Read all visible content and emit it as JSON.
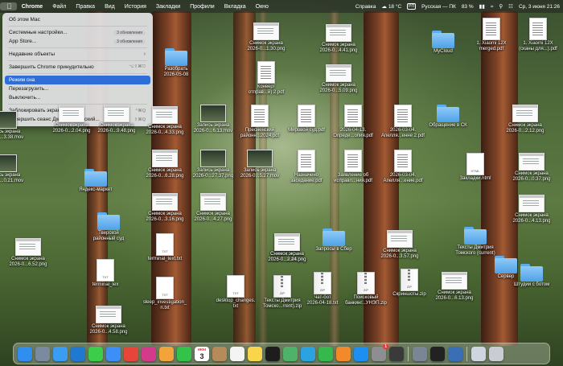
{
  "menubar": {
    "apple_icon": "apple-icon",
    "app_name": "Chrome",
    "menus": [
      "Файл",
      "Правка",
      "Вид",
      "История",
      "Закладки",
      "Профили",
      "Вкладка",
      "Окно"
    ],
    "right": {
      "help": "Справка",
      "weather": "18 °C",
      "keyboard_badge": "РП",
      "input_source": "Русская — ПК",
      "battery": "83 %",
      "datetime": "Ср, 3 июня 21:26"
    }
  },
  "apple_menu": {
    "items": [
      {
        "label": "Об этом Mac"
      },
      {
        "separator": true
      },
      {
        "label": "Системные настройки...",
        "badge": "3 обновления"
      },
      {
        "label": "App Store...",
        "badge": "3 обновления"
      },
      {
        "separator": true
      },
      {
        "label": "Недавние объекты",
        "submenu": "›"
      },
      {
        "separator": true
      },
      {
        "label": "Завершить Chrome принудительно",
        "shortcut": "⌥⇧⌘⎋"
      },
      {
        "separator": true
      },
      {
        "label": "Режим сна",
        "highlighted": true
      },
      {
        "label": "Перезагрузить..."
      },
      {
        "label": "Выключить..."
      },
      {
        "separator": true
      },
      {
        "label": "Заблокировать экран",
        "shortcut": "^⌘Q"
      },
      {
        "label": "Завершить сеанс Дмитрий Томский...",
        "shortcut": "⇧⌘Q"
      }
    ]
  },
  "desktop": {
    "items": [
      {
        "kind": "shot",
        "label": "Снимок экрана\n2026-0...1.30.png"
      },
      {
        "kind": "shot",
        "label": "Снимок экрана\n2026-0...4.41.png"
      },
      {
        "kind": "doc",
        "label": "1. Xiaomi 12X\nmerged.pdf"
      },
      {
        "kind": "doc",
        "label": "1. Xiaomi 12X\n(сканы для...).pdf"
      },
      {
        "kind": "folder",
        "label": "MyCloud"
      },
      {
        "kind": "folder",
        "label": "Разобрать\n2026-05-08"
      },
      {
        "kind": "doc",
        "label": "Конверт\nотправ...й) 2.pdf"
      },
      {
        "kind": "shot",
        "label": "Снимок экрана\n2026-0...5.09.png"
      },
      {
        "kind": "mov",
        "label": "Запись экрана\n2026-0...3.38.mov"
      },
      {
        "kind": "shot",
        "label": "Снимок экрана\n2026-0...2.04.png"
      },
      {
        "kind": "shot",
        "label": "Снимок экрана\n2026-0...9.48.png"
      },
      {
        "kind": "shot",
        "label": "Снимок экрана\n2026-0...4.33.png"
      },
      {
        "kind": "mov",
        "label": "Запись экрана\n2026-0...6.13.mov"
      },
      {
        "kind": "doc",
        "label": "Пресненский\nрайонн...2024.pdf"
      },
      {
        "kind": "doc",
        "label": "Мировой суд.pdf"
      },
      {
        "kind": "doc",
        "label": "2026-04-13.\nОпреде...опия.pdf"
      },
      {
        "kind": "doc",
        "label": "2026-03-04.\nАпелля...енне 2.pdf"
      },
      {
        "kind": "folder",
        "label": "Обращение в СК"
      },
      {
        "kind": "shot",
        "label": "Снимок экрана\n2026-0...2.12.png"
      },
      {
        "kind": "mov",
        "label": "Запись экрана\n2026-0...0.21.mov"
      },
      {
        "kind": "shot",
        "label": "Снимок экрана\n2026-0...6.28.png"
      },
      {
        "kind": "mov",
        "label": "Запись экрана\n2026-0...27.37.png"
      },
      {
        "kind": "mov",
        "label": "Запись экрана\n2026-0...5.27.mov"
      },
      {
        "kind": "doc",
        "label": "Назначено\nзаседание.pdf"
      },
      {
        "kind": "doc",
        "label": "Заявление об\nисправл...ния.pdf"
      },
      {
        "kind": "doc",
        "label": "2026-03-04.\nАпелля...ение.pdf"
      },
      {
        "kind": "html",
        "label": "Закладки.html"
      },
      {
        "kind": "shot",
        "label": "Снимок экрана\n2026-0...0.37.png"
      },
      {
        "kind": "folder",
        "label": "Яндекс-маркет"
      },
      {
        "kind": "shot",
        "label": "Снимок экрана\n2026-0...3.16.png"
      },
      {
        "kind": "shot",
        "label": "Снимок экрана\n2026-0...4.27.png"
      },
      {
        "kind": "shot",
        "label": "Снимок экрана\n2026-0...4.13.png"
      },
      {
        "kind": "folder",
        "label": "Тверской\nрайонный суд"
      },
      {
        "kind": "txt",
        "label": "terminal_text.txt"
      },
      {
        "kind": "shot",
        "label": "Снимок экрана\n2026-0...8.46.png"
      },
      {
        "kind": "folder",
        "label": "Запросы в Сбер"
      },
      {
        "kind": "shot",
        "label": "Снимок экрана\n2026-0...3.57.png"
      },
      {
        "kind": "folder",
        "label": "Тексты Дмитрия\nТомского (current)"
      },
      {
        "kind": "shot",
        "label": "Снимок экрана\n2026-0...6.52.png"
      },
      {
        "kind": "shot",
        "label": "Снимок экрана\n2026-0...2.24.png"
      },
      {
        "kind": "folder",
        "label": "Штудии с ботом"
      },
      {
        "kind": "txt",
        "label": "terminal_tex"
      },
      {
        "kind": "txt",
        "label": "sleep_investigation_\nn.txt"
      },
      {
        "kind": "txt",
        "label": "desktop_changes.\ntxt"
      },
      {
        "kind": "zip",
        "label": "Тексты Дмитрия\nТомско...rrent).zip"
      },
      {
        "kind": "zip",
        "label": "Чат-бот\n2026-04-18.txt"
      },
      {
        "kind": "zip",
        "label": "Поисковый\nбанкинг...УНЭП.zip"
      },
      {
        "kind": "zip",
        "label": "Скриншоты.zip"
      },
      {
        "kind": "shot",
        "label": "Снимок экрана\n2026-0...6.13.png"
      },
      {
        "kind": "folder",
        "label": "Сервер"
      },
      {
        "kind": "shot",
        "label": "Снимок экрана\n2026-0...4.58.png"
      }
    ]
  },
  "dock": {
    "calendar_month": "июн",
    "calendar_day": "3",
    "settings_badge": "1",
    "apps": [
      {
        "name": "finder-icon",
        "color": "#2f8ef0"
      },
      {
        "name": "launchpad-icon",
        "color": "#7c8aa0"
      },
      {
        "name": "safari-icon",
        "color": "#3a9cf2"
      },
      {
        "name": "vscode-icon",
        "color": "#1f79d0"
      },
      {
        "name": "messages-icon",
        "color": "#3ccd4b"
      },
      {
        "name": "mail-icon",
        "color": "#3d8ef6"
      },
      {
        "name": "chrome-icon",
        "color": "#e7453a"
      },
      {
        "name": "yandex-browser-icon",
        "color": "#d43a8a"
      },
      {
        "name": "photos-icon",
        "color": "#f2a33a"
      },
      {
        "name": "facetime-icon",
        "color": "#33c24a"
      },
      {
        "name": "calendar-icon",
        "color": "#ffffff"
      },
      {
        "name": "contacts-icon",
        "color": "#b68b5a"
      },
      {
        "name": "reminders-icon",
        "color": "#f4f4f4"
      },
      {
        "name": "notes-icon",
        "color": "#f8d54a"
      },
      {
        "name": "stocks-icon",
        "color": "#1d1d1d"
      },
      {
        "name": "maps-icon",
        "color": "#4fb26a"
      },
      {
        "name": "telegram-icon",
        "color": "#2aa3e0"
      },
      {
        "name": "numbers-icon",
        "color": "#35b94a"
      },
      {
        "name": "pages-icon",
        "color": "#f38a2a"
      },
      {
        "name": "app-store-icon",
        "color": "#1d8ef2"
      },
      {
        "name": "system-settings-icon",
        "color": "#8d8d92"
      },
      {
        "name": "activity-monitor-icon",
        "color": "#3a3a3a"
      },
      {
        "name": "screenshot-icon",
        "color": "#7a8596"
      },
      {
        "name": "terminal-icon",
        "color": "#222222"
      },
      {
        "name": "quicktime-icon",
        "color": "#3a6fb5"
      },
      {
        "name": "downloads-stack-icon",
        "color": "#cfd6e0"
      },
      {
        "name": "trash-icon",
        "color": "#c9ccd2"
      }
    ]
  }
}
